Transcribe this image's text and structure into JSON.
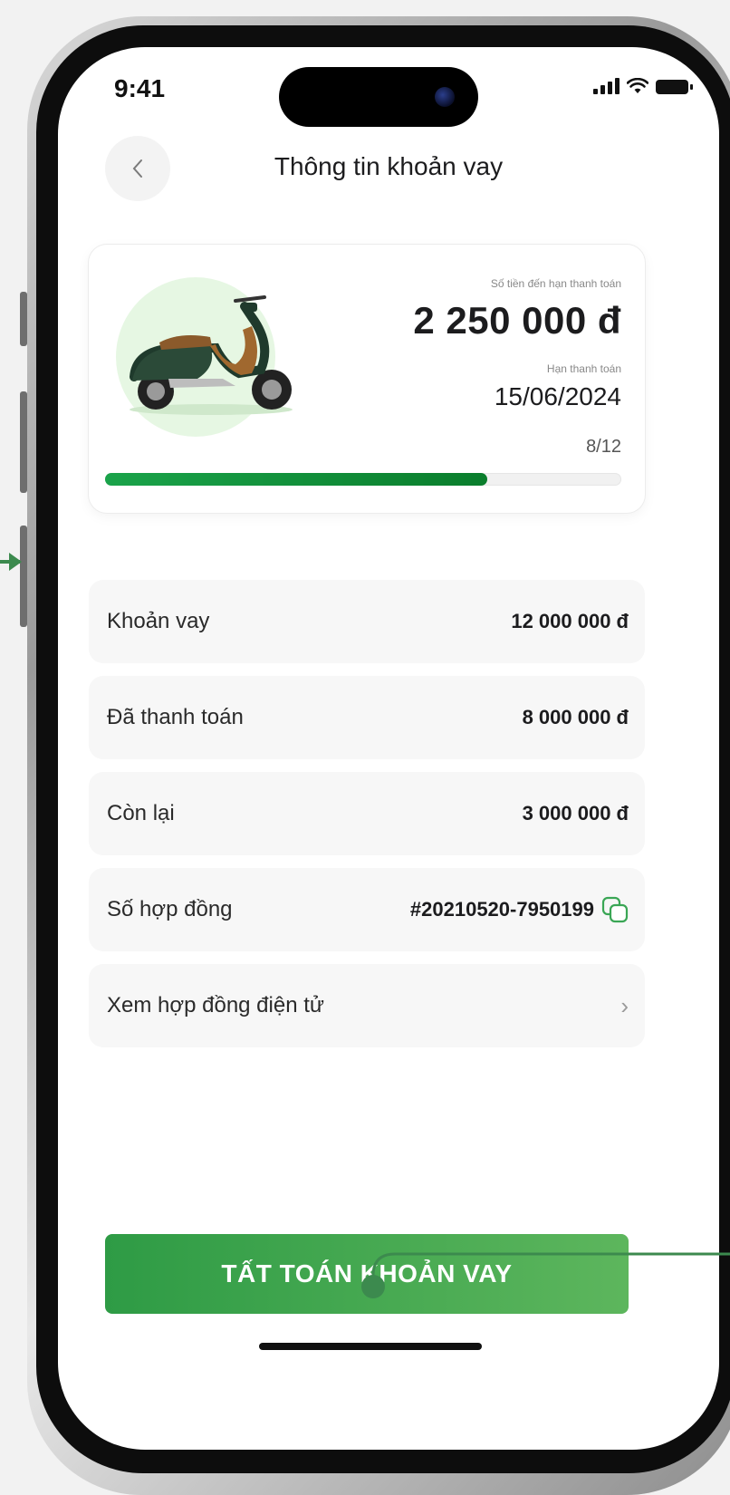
{
  "status_bar": {
    "time": "9:41"
  },
  "header": {
    "title": "Thông tin khoản vay",
    "back_icon": "chevron-left-icon"
  },
  "loan_card": {
    "due_amount_label": "Số tiền đến hạn thanh toán",
    "due_amount": "2 250 000 đ",
    "due_date_label": "Hạn thanh toán",
    "due_date": "15/06/2024",
    "progress_text": "8/12",
    "progress_fraction": 0.74
  },
  "details": [
    {
      "label": "Khoản vay",
      "value": "12 000 000 đ"
    },
    {
      "label": "Đã thanh toán",
      "value": "8 000 000 đ"
    },
    {
      "label": "Còn lại",
      "value": "3 000 000 đ"
    },
    {
      "label": "Số hợp đồng",
      "value": "#20210520-7950199",
      "icon": "copy-icon"
    }
  ],
  "contract_link": {
    "label": "Xem hợp đồng điện tử",
    "icon": "chevron-right-icon"
  },
  "cta": {
    "label": "TẤT TOÁN KHOẢN VAY"
  },
  "colors": {
    "accent": "#2e9b45",
    "progress": "#1aa34a",
    "annotation": "#3c8a4e"
  }
}
